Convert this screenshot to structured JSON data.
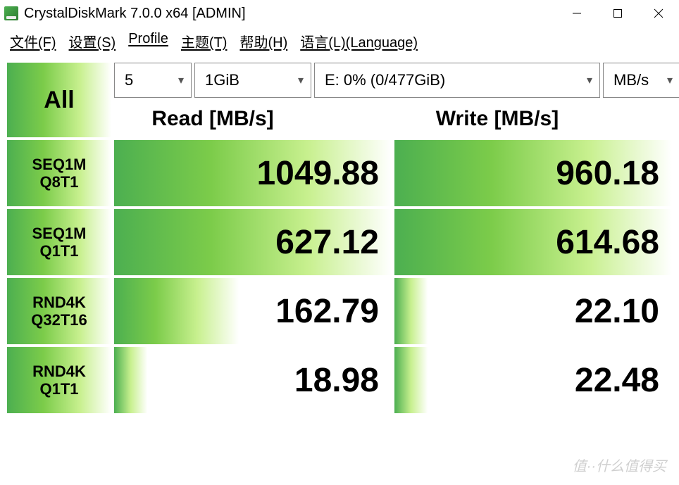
{
  "window": {
    "title": "CrystalDiskMark 7.0.0 x64 [ADMIN]"
  },
  "menu": {
    "file": "文件(F)",
    "settings": "设置(S)",
    "profile": "Profile",
    "theme": "主题(T)",
    "help": "帮助(H)",
    "language": "语言(L)(Language)"
  },
  "controls": {
    "runs": "5",
    "size": "1GiB",
    "drive": "E: 0% (0/477GiB)",
    "unit": "MB/s",
    "all_label": "All"
  },
  "headers": {
    "read": "Read [MB/s]",
    "write": "Write [MB/s]"
  },
  "tests": [
    {
      "line1": "SEQ1M",
      "line2": "Q8T1",
      "read": "1049.88",
      "write": "960.18",
      "fill_r": "hi",
      "fill_w": "hi"
    },
    {
      "line1": "SEQ1M",
      "line2": "Q1T1",
      "read": "627.12",
      "write": "614.68",
      "fill_r": "hi",
      "fill_w": "hi"
    },
    {
      "line1": "RND4K",
      "line2": "Q32T16",
      "read": "162.79",
      "write": "22.10",
      "fill_r": "low",
      "fill_w": "vlow"
    },
    {
      "line1": "RND4K",
      "line2": "Q1T1",
      "read": "18.98",
      "write": "22.48",
      "fill_r": "vlow",
      "fill_w": "vlow"
    }
  ],
  "watermark": "值··什么值得买"
}
